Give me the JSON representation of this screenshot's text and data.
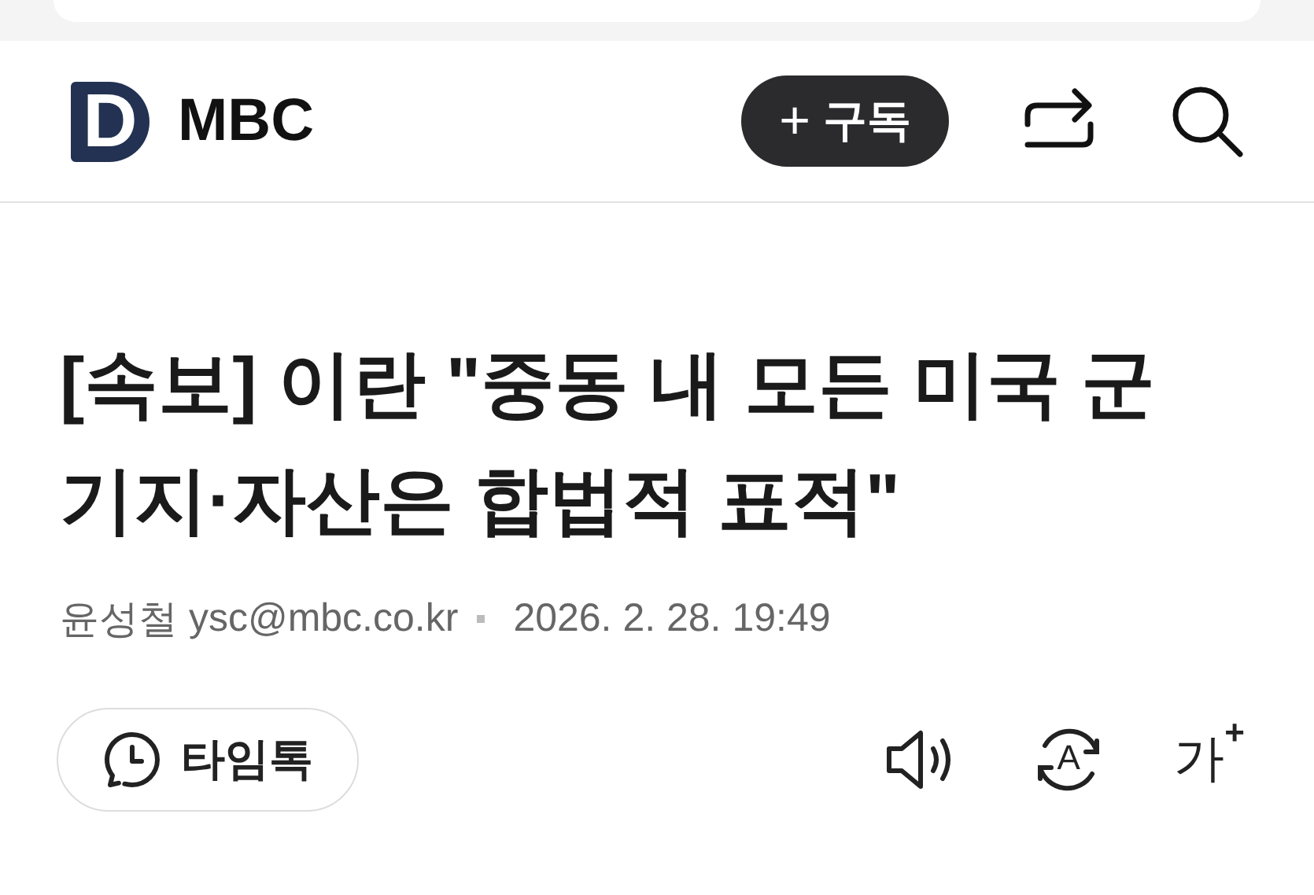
{
  "header": {
    "logo_letter": "D",
    "brand": "MBC",
    "subscribe_button": {
      "icon": "+",
      "label": "구독"
    }
  },
  "article": {
    "headline": "[속보] 이란 \"중동 내 모든 미국 군 기지·자산은 합법적 표적\"",
    "author": "윤성철",
    "email": "ysc@mbc.co.kr",
    "date": "2026. 2. 28. 19:49"
  },
  "toolbar": {
    "timetalk_button": "타임톡",
    "translate_letter": "A",
    "font_size_button": {
      "label": "가",
      "mark": "+"
    }
  }
}
